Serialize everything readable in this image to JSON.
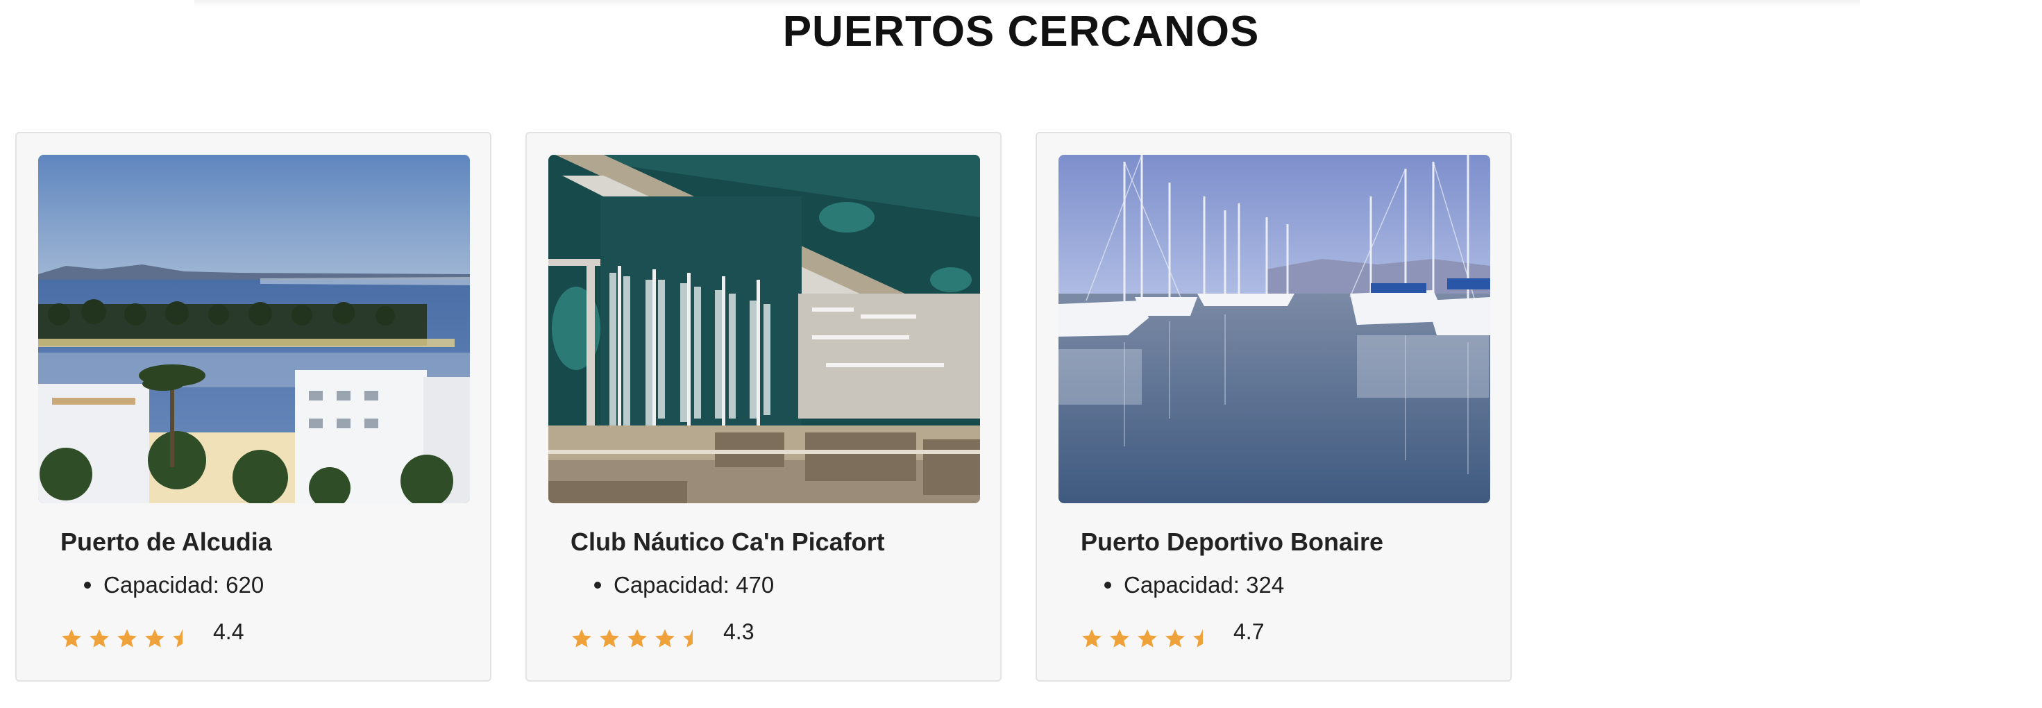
{
  "section": {
    "title": "PUERTOS CERCANOS"
  },
  "ports": [
    {
      "name": "Puerto de Alcudia",
      "capacity_label": "Capacidad: 620",
      "rating": 4.4,
      "rating_text": "4.4"
    },
    {
      "name": "Club Náutico Ca'n Picafort",
      "capacity_label": "Capacidad: 470",
      "rating": 4.3,
      "rating_text": "4.3"
    },
    {
      "name": "Puerto Deportivo Bonaire",
      "capacity_label": "Capacidad: 324",
      "rating": 4.7,
      "rating_text": "4.7"
    }
  ],
  "colors": {
    "star": "#f0a23a",
    "star_empty": "#d6d6d6"
  }
}
